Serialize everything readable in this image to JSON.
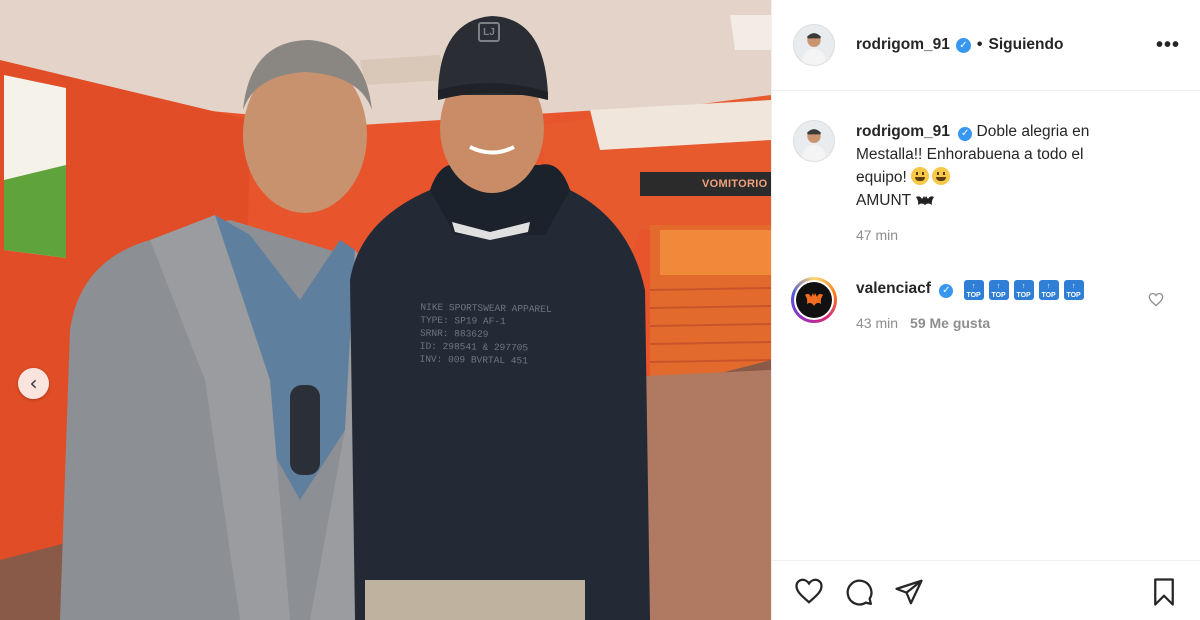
{
  "post": {
    "author": {
      "username": "rodrigom_91",
      "verified": true,
      "follow_separator": "•",
      "follow_status": "Siguiendo"
    },
    "more_options_label": "•••",
    "photo": {
      "carousel_prev_icon": "chevron-left-icon",
      "sign_text": "VOMITORIO",
      "cap_logo_text": "LJ",
      "hoodie_print": [
        "NIKE SPORTSWEAR APPAREL",
        "TYPE: SP19 AF-1",
        "SRNR: 883629",
        "ID: 298541 & 297705",
        "INV: 009 BVRTAL 451"
      ]
    },
    "caption": {
      "author": "rodrigom_91",
      "text": "Doble alegria en Mestalla!! Enhorabuena a todo el equipo!",
      "line2": "AMUNT",
      "time": "47 min"
    },
    "comments": [
      {
        "author": "valenciacf",
        "verified": true,
        "top_emoji_label": "TOP",
        "time": "43 min",
        "likes": "59 Me gusta"
      }
    ],
    "icons": {
      "like": "heart-icon",
      "comment": "comment-icon",
      "share": "send-icon",
      "save": "bookmark-icon",
      "verified": "verified-badge-icon"
    },
    "colors": {
      "verified_blue": "#3897f0",
      "wall_orange": "#e8542b",
      "text_primary": "#262626",
      "text_secondary": "#8e8e8e"
    }
  }
}
